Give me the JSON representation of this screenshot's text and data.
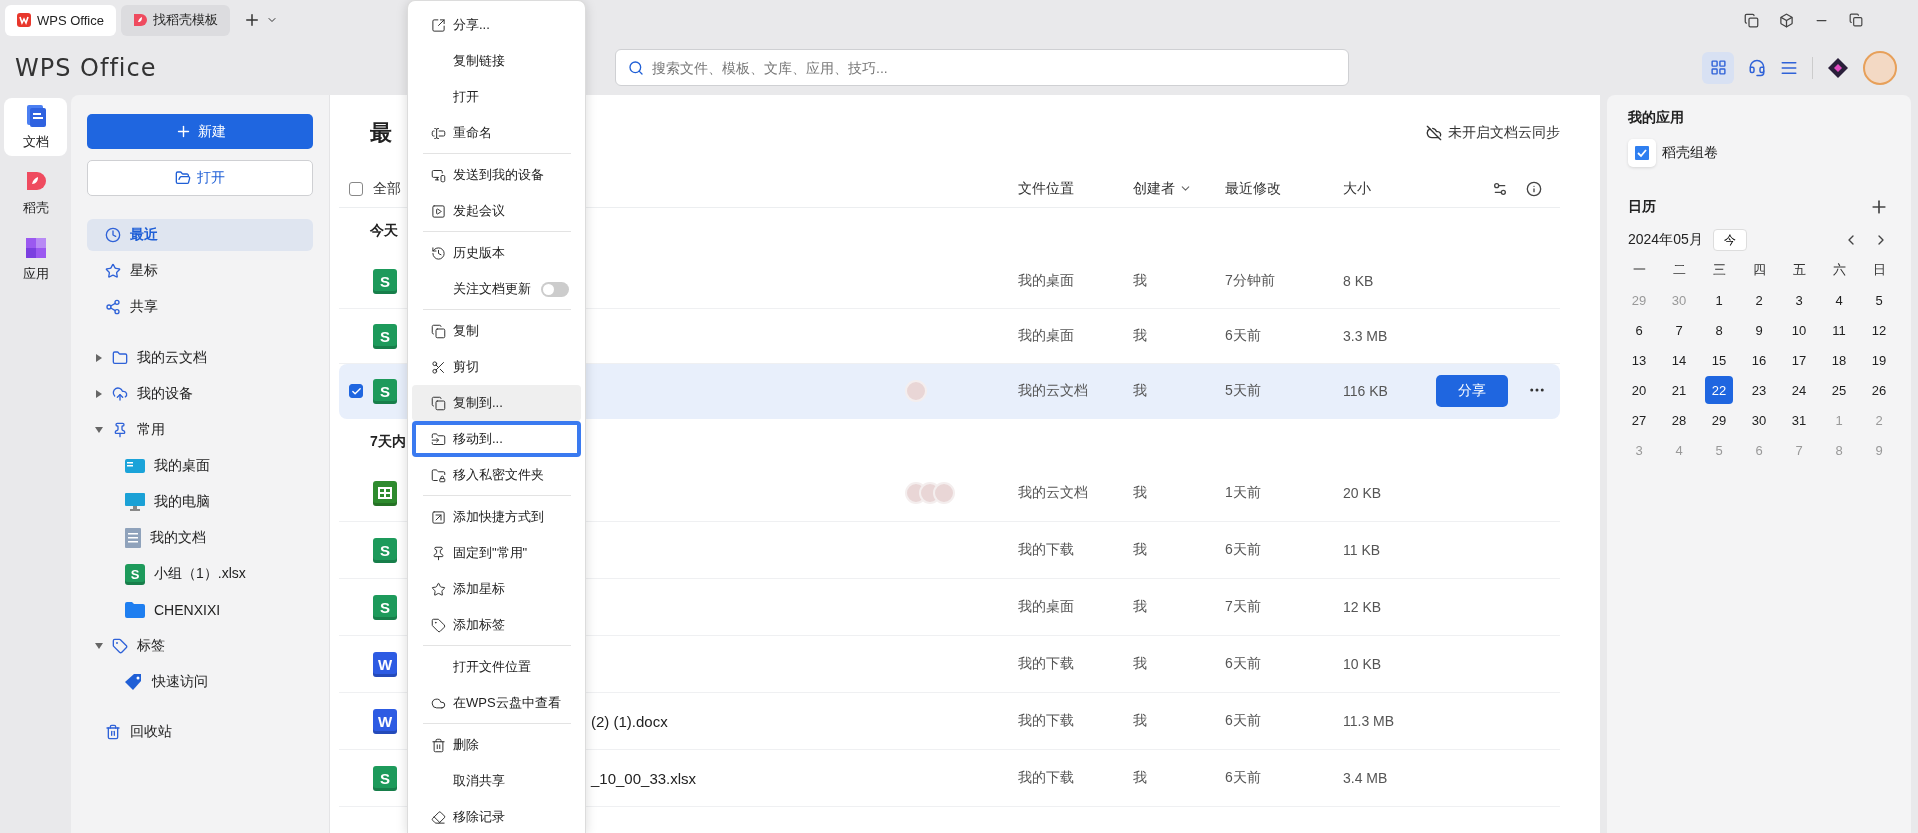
{
  "tabs": [
    {
      "label": "WPS Office",
      "selected": true
    },
    {
      "label": "找稻壳模板",
      "selected": false
    }
  ],
  "app_name": "WPS Office",
  "search": {
    "placeholder": "搜索文件、模板、文库、应用、技巧..."
  },
  "rail": [
    {
      "label": "文档",
      "selected": true
    },
    {
      "label": "稻壳",
      "selected": false
    },
    {
      "label": "应用",
      "selected": false
    }
  ],
  "nav": {
    "new_button": "新建",
    "open_button": "打开",
    "items": [
      {
        "label": "最近",
        "selected": true
      },
      {
        "label": "星标",
        "selected": false
      },
      {
        "label": "共享",
        "selected": false
      }
    ],
    "tree": [
      {
        "label": "我的云文档",
        "expanded": false
      },
      {
        "label": "我的设备",
        "expanded": false
      },
      {
        "label": "常用",
        "expanded": true,
        "children": [
          {
            "label": "我的桌面",
            "kind": "desktop"
          },
          {
            "label": "我的电脑",
            "kind": "computer"
          },
          {
            "label": "我的文档",
            "kind": "document"
          },
          {
            "label": "小组（1）.xlsx",
            "kind": "sheet",
            "icon_text": "S"
          },
          {
            "label": "CHENXIXI",
            "kind": "folder"
          }
        ]
      },
      {
        "label": "标签",
        "expanded": true,
        "children": [
          {
            "label": "快速访问",
            "kind": "tag"
          }
        ]
      }
    ],
    "trash": "回收站"
  },
  "main": {
    "title": "最",
    "sync": "未开启文档云同步",
    "all_checked": false,
    "columns": {
      "all": "全部",
      "location": "文件位置",
      "creator": "创建者",
      "modified": "最近修改",
      "size": "大小"
    },
    "sections": [
      {
        "label": "今天",
        "rows": [
          {
            "kind": "sheet",
            "icon_text": "S",
            "selected": false,
            "location": "我的桌面",
            "creator": "我",
            "modified": "7分钟前",
            "size": "8 KB"
          },
          {
            "kind": "sheet",
            "icon_text": "S",
            "selected": false,
            "location": "我的桌面",
            "creator": "我",
            "modified": "6天前",
            "size": "3.3 MB"
          },
          {
            "kind": "sheet",
            "icon_text": "S",
            "selected": true,
            "avatars": [
              {
                "kind": "photo"
              }
            ],
            "location": "我的云文档",
            "creator": "我",
            "modified": "5天前",
            "size": "116 KB",
            "share_button": "分享"
          }
        ]
      },
      {
        "label": "7天内",
        "rows": [
          {
            "kind": "table",
            "selected": false,
            "avatars": [
              {
                "kind": "photo"
              },
              {
                "kind": "photo"
              },
              {
                "kind": "photo"
              }
            ],
            "location": "我的云文档",
            "creator": "我",
            "modified": "1天前",
            "size": "20 KB"
          },
          {
            "kind": "sheet",
            "icon_text": "S",
            "selected": false,
            "location": "我的下载",
            "creator": "我",
            "modified": "6天前",
            "size": "11 KB"
          },
          {
            "kind": "sheet",
            "icon_text": "S",
            "selected": false,
            "location": "我的桌面",
            "creator": "我",
            "modified": "7天前",
            "size": "12 KB"
          },
          {
            "kind": "word",
            "icon_text": "W",
            "selected": false,
            "location": "我的下载",
            "creator": "我",
            "modified": "6天前",
            "size": "10 KB"
          },
          {
            "kind": "word",
            "icon_text": "W",
            "selected": false,
            "name": "(2) (1).docx",
            "location": "我的下载",
            "creator": "我",
            "modified": "6天前",
            "size": "11.3 MB"
          },
          {
            "kind": "sheet",
            "icon_text": "S",
            "selected": false,
            "name": "_10_00_33.xlsx",
            "location": "我的下载",
            "creator": "我",
            "modified": "6天前",
            "size": "3.4 MB"
          }
        ]
      }
    ]
  },
  "menu": {
    "groups": [
      [
        {
          "label": "分享...",
          "hovered": false,
          "selected": false
        },
        {
          "label": "复制链接",
          "hovered": false,
          "selected": false
        },
        {
          "label": "打开",
          "hovered": false,
          "selected": false
        },
        {
          "label": "重命名",
          "hovered": false,
          "selected": false
        }
      ],
      [
        {
          "label": "发送到我的设备",
          "hovered": false,
          "selected": false
        },
        {
          "label": "发起会议",
          "hovered": false,
          "selected": false
        }
      ],
      [
        {
          "label": "历史版本",
          "hovered": false,
          "selected": false
        },
        {
          "label": "关注文档更新",
          "hovered": false,
          "selected": false,
          "kind": "toggle",
          "on": false
        }
      ],
      [
        {
          "label": "复制",
          "hovered": false,
          "selected": false
        },
        {
          "label": "剪切",
          "hovered": false,
          "selected": false
        },
        {
          "label": "复制到...",
          "hovered": true,
          "selected": false
        },
        {
          "label": "移动到...",
          "hovered": false,
          "selected": true
        },
        {
          "label": "移入私密文件夹",
          "hovered": false,
          "selected": false
        }
      ],
      [
        {
          "label": "添加快捷方式到",
          "hovered": false,
          "selected": false
        },
        {
          "label": "固定到\"常用\"",
          "hovered": false,
          "selected": false
        },
        {
          "label": "添加星标",
          "hovered": false,
          "selected": false
        },
        {
          "label": "添加标签",
          "hovered": false,
          "selected": false
        }
      ],
      [
        {
          "label": "打开文件位置",
          "hovered": false,
          "selected": false
        },
        {
          "label": "在WPS云盘中查看",
          "hovered": false,
          "selected": false
        }
      ],
      [
        {
          "label": "删除",
          "hovered": false,
          "selected": false
        },
        {
          "label": "取消共享",
          "hovered": false,
          "selected": false
        },
        {
          "label": "移除记录",
          "hovered": false,
          "selected": false
        }
      ]
    ]
  },
  "my_apps": {
    "title": "我的应用",
    "apps": [
      {
        "label": "稻壳组卷"
      }
    ]
  },
  "calendar": {
    "title": "日历",
    "month": "2024年05月",
    "today_button": "今",
    "weekdays": [
      "一",
      "二",
      "三",
      "四",
      "五",
      "六",
      "日"
    ],
    "days": [
      {
        "day": "29",
        "muted": true,
        "selected": false
      },
      {
        "day": "30",
        "muted": true,
        "selected": false
      },
      {
        "day": "1",
        "muted": false,
        "selected": false
      },
      {
        "day": "2",
        "muted": false,
        "selected": false
      },
      {
        "day": "3",
        "muted": false,
        "selected": false
      },
      {
        "day": "4",
        "muted": false,
        "selected": false
      },
      {
        "day": "5",
        "muted": false,
        "selected": false
      },
      {
        "day": "6",
        "muted": false,
        "selected": false
      },
      {
        "day": "7",
        "muted": false,
        "selected": false
      },
      {
        "day": "8",
        "muted": false,
        "selected": false
      },
      {
        "day": "9",
        "muted": false,
        "selected": false
      },
      {
        "day": "10",
        "muted": false,
        "selected": false
      },
      {
        "day": "11",
        "muted": false,
        "selected": false
      },
      {
        "day": "12",
        "muted": false,
        "selected": false
      },
      {
        "day": "13",
        "muted": false,
        "selected": false
      },
      {
        "day": "14",
        "muted": false,
        "selected": false
      },
      {
        "day": "15",
        "muted": false,
        "selected": false
      },
      {
        "day": "16",
        "muted": false,
        "selected": false
      },
      {
        "day": "17",
        "muted": false,
        "selected": false
      },
      {
        "day": "18",
        "muted": false,
        "selected": false
      },
      {
        "day": "19",
        "muted": false,
        "selected": false
      },
      {
        "day": "20",
        "muted": false,
        "selected": false
      },
      {
        "day": "21",
        "muted": false,
        "selected": false
      },
      {
        "day": "22",
        "muted": false,
        "selected": true
      },
      {
        "day": "23",
        "muted": false,
        "selected": false
      },
      {
        "day": "24",
        "muted": false,
        "selected": false
      },
      {
        "day": "25",
        "muted": false,
        "selected": false
      },
      {
        "day": "26",
        "muted": false,
        "selected": false
      },
      {
        "day": "27",
        "muted": false,
        "selected": false
      },
      {
        "day": "28",
        "muted": false,
        "selected": false
      },
      {
        "day": "29",
        "muted": false,
        "selected": false
      },
      {
        "day": "30",
        "muted": false,
        "selected": false
      },
      {
        "day": "31",
        "muted": false,
        "selected": false
      },
      {
        "day": "1",
        "muted": true,
        "selected": false
      },
      {
        "day": "2",
        "muted": true,
        "selected": false
      },
      {
        "day": "3",
        "muted": true,
        "selected": false
      },
      {
        "day": "4",
        "muted": true,
        "selected": false
      },
      {
        "day": "5",
        "muted": true,
        "selected": false
      },
      {
        "day": "6",
        "muted": true,
        "selected": false
      },
      {
        "day": "7",
        "muted": true,
        "selected": false
      },
      {
        "day": "8",
        "muted": true,
        "selected": false
      },
      {
        "day": "9",
        "muted": true,
        "selected": false
      }
    ]
  }
}
